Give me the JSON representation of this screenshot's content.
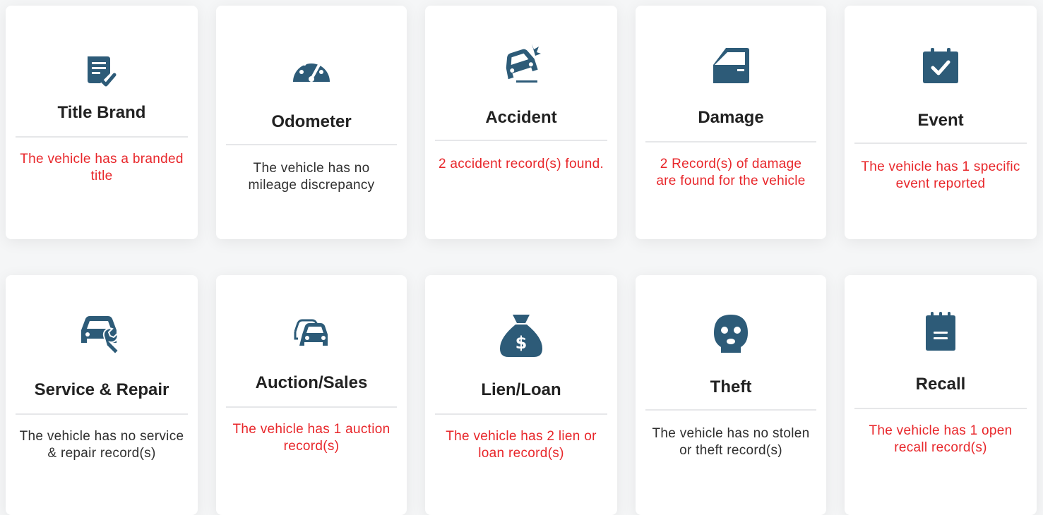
{
  "colors": {
    "icon": "#2d5b78",
    "alert_text": "#e8262a",
    "normal_text": "#2f2f2f"
  },
  "row1": [
    {
      "icon": "document-check-icon",
      "title": "Title Brand",
      "text": "The vehicle has a branded title",
      "status": "alert"
    },
    {
      "icon": "speedometer-icon",
      "title": "Odometer",
      "text": "The vehicle has no mileage discrepancy",
      "status": "ok"
    },
    {
      "icon": "car-crash-icon",
      "title": "Accident",
      "text": "2 accident record(s) found.",
      "status": "alert"
    },
    {
      "icon": "car-door-icon",
      "title": "Damage",
      "text": "2 Record(s) of damage are found for the vehicle",
      "status": "alert"
    },
    {
      "icon": "calendar-check-icon",
      "title": "Event",
      "text": "The vehicle has 1 specific event reported",
      "status": "alert"
    }
  ],
  "row2": [
    {
      "icon": "car-wrench-icon",
      "title": "Service & Repair",
      "text": "The vehicle has no service & repair record(s)",
      "status": "ok"
    },
    {
      "icon": "cars-icon",
      "title": "Auction/Sales",
      "text": "The vehicle has 1 auction record(s)",
      "status": "alert"
    },
    {
      "icon": "money-bag-icon",
      "title": "Lien/Loan",
      "text": "The vehicle has 2 lien or loan record(s)",
      "status": "alert"
    },
    {
      "icon": "thief-mask-icon",
      "title": "Theft",
      "text": "The vehicle has no stolen or theft record(s)",
      "status": "ok"
    },
    {
      "icon": "notepad-icon",
      "title": "Recall",
      "text": "The vehicle has 1 open recall record(s)",
      "status": "alert"
    }
  ]
}
